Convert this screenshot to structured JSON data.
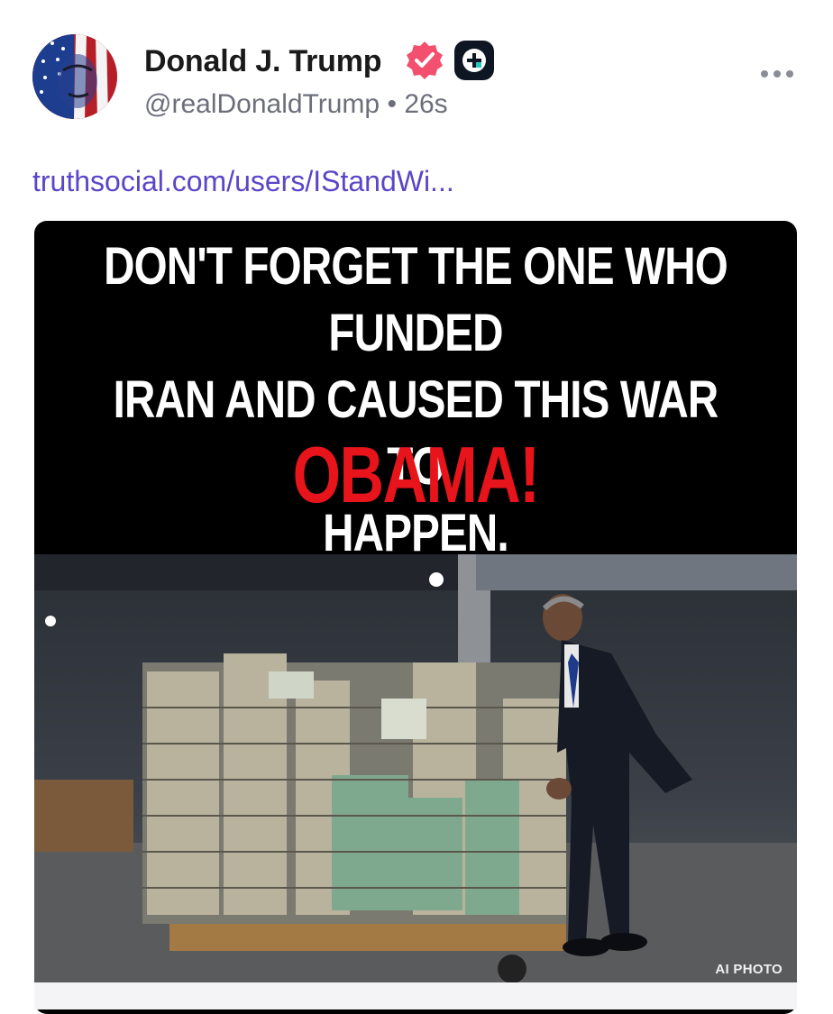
{
  "post": {
    "author_name": "Donald J. Trump",
    "handle": "@realDonaldTrump",
    "separator": "•",
    "time": "26s",
    "link_text": "truthsocial.com/users/IStandWi..."
  },
  "image": {
    "headline_lines": [
      "DON'T FORGET THE ONE WHO FUNDED",
      "IRAN AND CAUSED THIS WAR TO",
      "HAPPEN."
    ],
    "shout": "OBAMA!",
    "watermark": "AI PHOTO"
  },
  "colors": {
    "link": "#5a46c7",
    "verified_badge": "#f2506e",
    "shout": "#e8141b",
    "muted_text": "#6c6f7a"
  },
  "icons": [
    "verified-badge-icon",
    "plus-badge-icon",
    "more-options-icon"
  ]
}
